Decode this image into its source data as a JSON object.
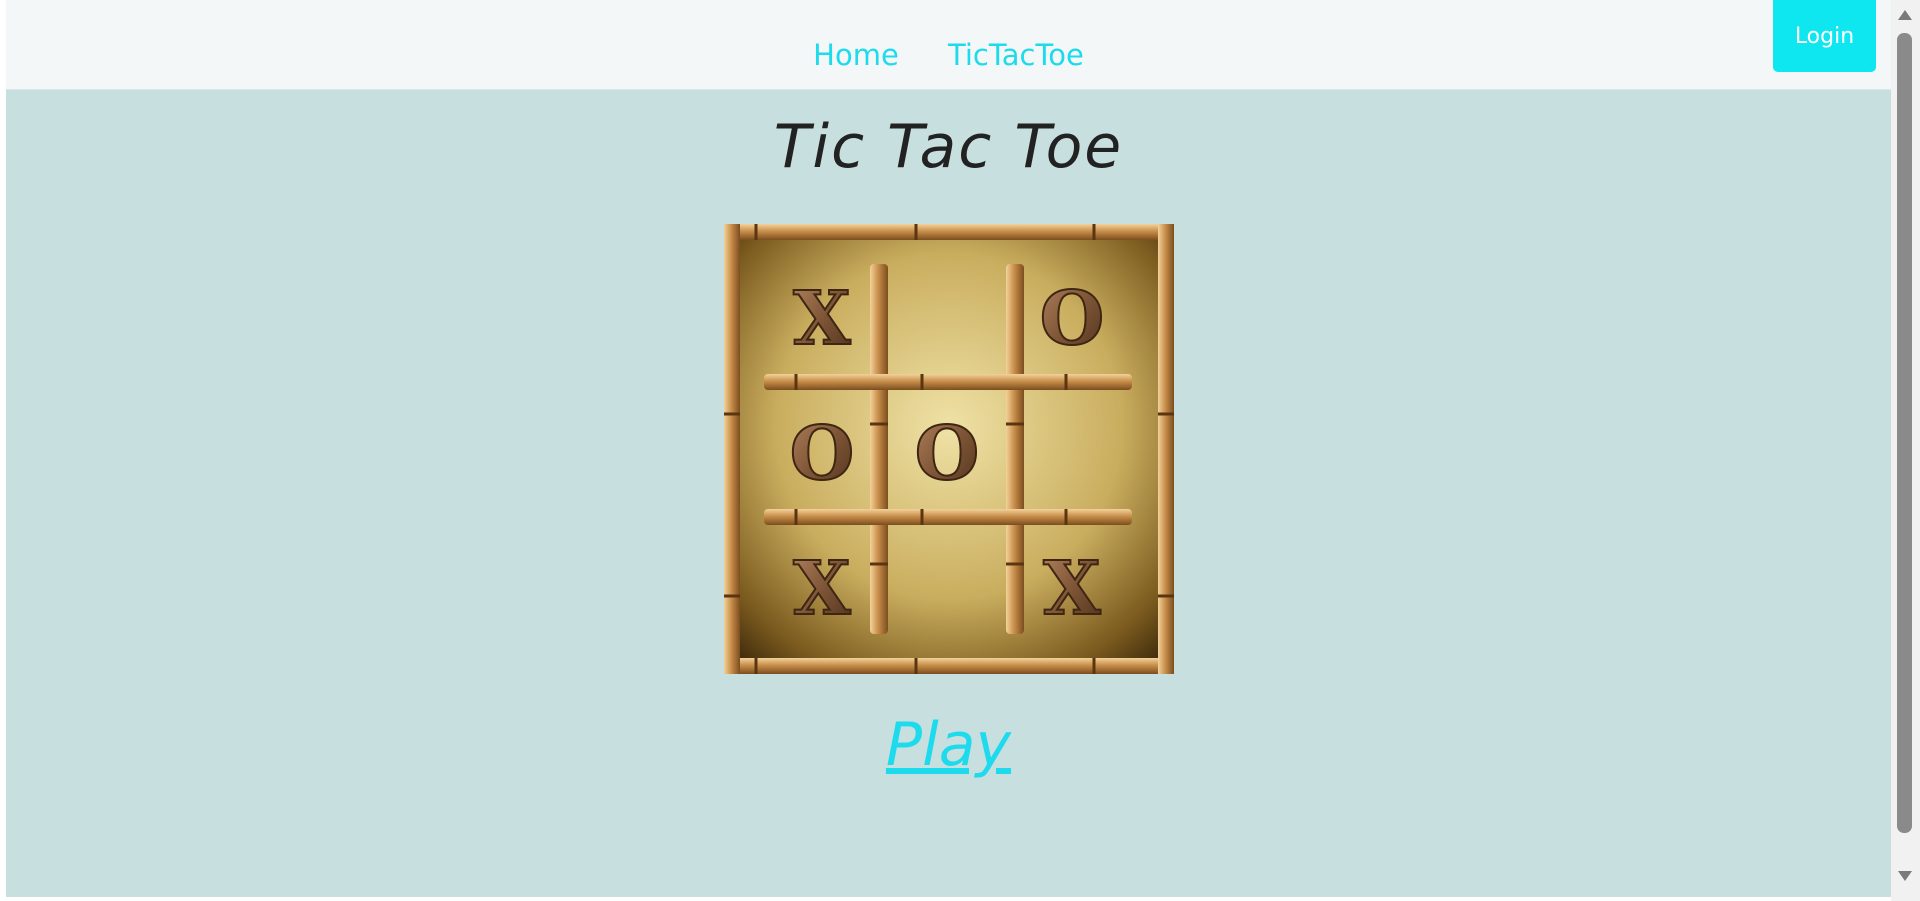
{
  "nav": {
    "links": [
      "Home",
      "TicTacToe"
    ],
    "login_label": "Login"
  },
  "main": {
    "title": "Tic Tac Toe",
    "play_label": "Play",
    "board": {
      "cells": [
        "X",
        "",
        "O",
        "O",
        "O",
        "",
        "X",
        "",
        "X"
      ]
    }
  },
  "colors": {
    "accent": "#1ddbec",
    "background": "#c8dfe0",
    "navbar": "#f4f7f8"
  }
}
